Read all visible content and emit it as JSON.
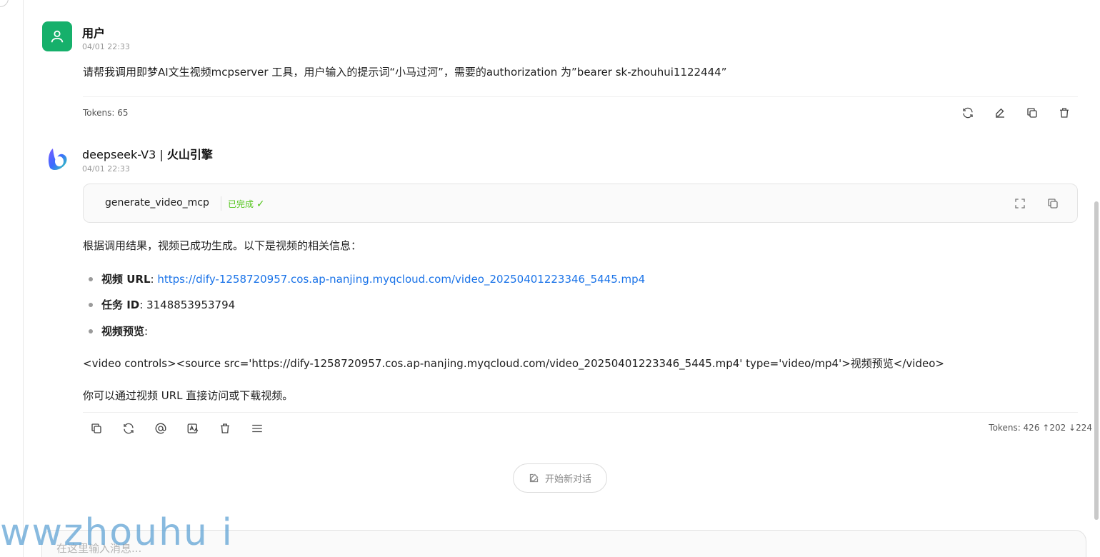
{
  "user_message": {
    "author": "用户",
    "time": "04/01 22:33",
    "text": "请帮我调用即梦AI文生视频mcpserver 工具，用户输入的提示词“小马过河”，需要的authorization 为”bearer sk-zhouhui1122444”",
    "tokens": "Tokens: 65",
    "actions": [
      "refresh-icon",
      "edit-icon",
      "copy-icon",
      "trash-icon"
    ]
  },
  "ai_message": {
    "model": "deepseek-V3",
    "separator": " | ",
    "provider": "火山引擎",
    "time": "04/01 22:33",
    "tool_call": {
      "name": "generate_video_mcp",
      "status": "已完成",
      "status_icon": "✓"
    },
    "intro": "根据调用结果，视频已成功生成。以下是视频的相关信息：",
    "items": [
      {
        "label": "视频 URL",
        "sep": ": ",
        "value": "https://dify-1258720957.cos.ap-nanjing.myqcloud.com/video_20250401223346_5445.mp4",
        "is_link": true
      },
      {
        "label": "任务 ID",
        "sep": ": ",
        "value": "3148853953794",
        "is_link": false
      },
      {
        "label": "视频预览",
        "sep": ":",
        "value": "",
        "is_link": false
      }
    ],
    "video_html": "<video controls><source src='https://dify-1258720957.cos.ap-nanjing.myqcloud.com/video_20250401223346_5445.mp4' type='video/mp4'>视频预览</video>",
    "outro": "你可以通过视频 URL 直接访问或下载视频。",
    "tokens": "Tokens: 426 ↑202 ↓224",
    "actions": [
      "copy-icon",
      "refresh-icon",
      "at-icon",
      "translate-icon",
      "trash-icon",
      "menu-icon"
    ]
  },
  "new_chat_label": "开始新对话",
  "input": {
    "placeholder": "在这里输入消息..."
  },
  "watermark": "wwzhouhu i",
  "colors": {
    "user_avatar": "#16b06b",
    "link": "#1a73e8",
    "status_done": "#52c41a"
  }
}
